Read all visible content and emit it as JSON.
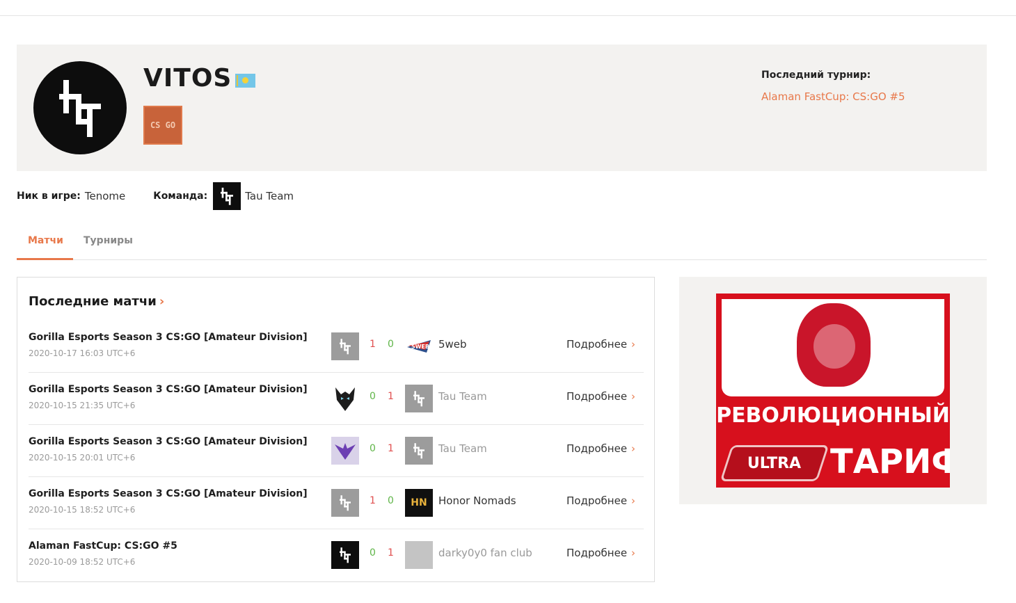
{
  "profile": {
    "nickname": "VITOS",
    "avatar_logo": "tau-logo",
    "flag": "kazakhstan-flag",
    "game_badge": "CS GO",
    "last_tournament_title": "Последний турнир:",
    "last_tournament_link": "Alaman FastCup: CS:GO #5"
  },
  "info": {
    "game_nick_label": "Ник в игре:",
    "game_nick_value": "Tenome",
    "team_label": "Команда:",
    "team_value": "Tau Team"
  },
  "tabs": [
    {
      "label": "Матчи",
      "active": true
    },
    {
      "label": "Турниры",
      "active": false
    }
  ],
  "matches": {
    "title": "Последние матчи",
    "chevron": "›",
    "more_label": "Подробнее",
    "rows": [
      {
        "tournament": "Gorilla Esports Season 3 CS:GO [Amateur Division]",
        "date": "2020-10-17 16:03 UTC+6",
        "score1": "1",
        "score2": "0",
        "logo1": "tau-logo-gray",
        "logo2": "5web-logo",
        "opponent": "5web"
      },
      {
        "tournament": "Gorilla Esports Season 3 CS:GO [Amateur Division]",
        "date": "2020-10-15 21:35 UTC+6",
        "score1": "0",
        "score2": "1",
        "logo1": "wolf-logo",
        "logo2": "tau-logo-gray",
        "opponent": "Tau Team"
      },
      {
        "tournament": "Gorilla Esports Season 3 CS:GO [Amateur Division]",
        "date": "2020-10-15 20:01 UTC+6",
        "score1": "0",
        "score2": "1",
        "logo1": "dragon-sense-logo",
        "logo2": "tau-logo-gray",
        "opponent": "Tau Team"
      },
      {
        "tournament": "Gorilla Esports Season 3 CS:GO [Amateur Division]",
        "date": "2020-10-15 18:52 UTC+6",
        "score1": "1",
        "score2": "0",
        "logo1": "tau-logo-gray",
        "logo2": "honor-nomads-logo",
        "opponent": "Honor Nomads"
      },
      {
        "tournament": "Alaman FastCup: CS:GO #5",
        "date": "2020-10-09 18:52 UTC+6",
        "score1": "0",
        "score2": "1",
        "logo1": "tau-logo-black",
        "logo2": "blank-avatar",
        "opponent": "darky0y0 fan club"
      }
    ]
  },
  "ad": {
    "headline": "РЕВОЛЮЦИОННЫЙ",
    "badge": "ULTRA",
    "tarif": "ТАРИФ",
    "accent": "#d7101d"
  },
  "colors": {
    "accent": "#e8784a",
    "win": "#5fb548",
    "lose": "#e04f4f"
  }
}
